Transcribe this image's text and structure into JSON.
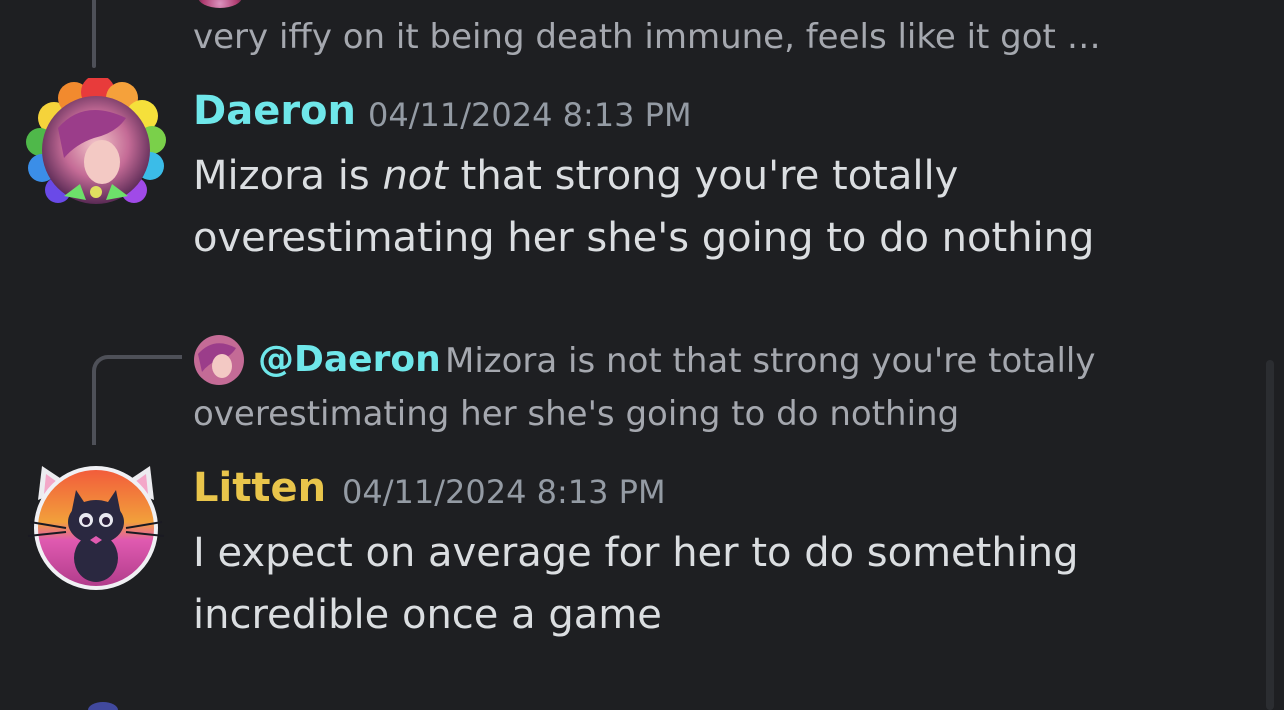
{
  "theme": {
    "background": "#1e1f22",
    "text": "#dbdee1",
    "muted": "#949ba4",
    "daeron_color": "#6fe7ea",
    "litten_color": "#e9c54b"
  },
  "previous_message": {
    "faded_text": "very iffy on it being death immune, feels like it got …"
  },
  "messages": [
    {
      "author": "Daeron",
      "timestamp": "04/11/2024 8:13 PM",
      "text_part1": "Mizora is ",
      "text_emphasis": "not",
      "text_part2": " that strong you're totally",
      "text_line2": "overestimating her she's going to do nothing",
      "avatar_icon": "daeron-avatar-rainbow-frame"
    },
    {
      "author": "Litten",
      "timestamp": "04/11/2024 8:13 PM",
      "reply": {
        "mention": "@Daeron",
        "preview_line1": "Mizora is not that strong you're totally",
        "preview_line2": "overestimating her she's going to do nothing"
      },
      "text_line1": "I expect on average for her to do something",
      "text_line2": "incredible once a game",
      "avatar_icon": "litten-avatar-cat-frame"
    }
  ]
}
